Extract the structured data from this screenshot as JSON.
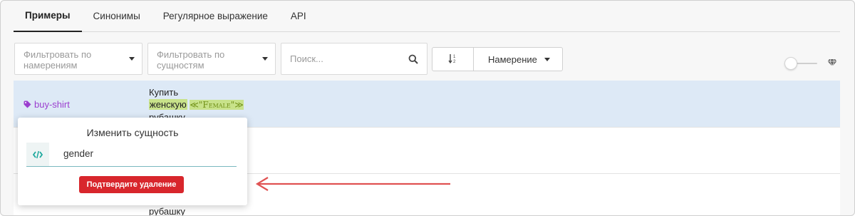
{
  "tabs": [
    {
      "label": "Примеры",
      "active": true
    },
    {
      "label": "Синонимы",
      "active": false
    },
    {
      "label": "Регулярное выражение",
      "active": false
    },
    {
      "label": "API",
      "active": false
    }
  ],
  "filters": {
    "intent_placeholder_line1": "Фильтровать по",
    "intent_placeholder_line2": "намерениям",
    "entity_placeholder_line1": "Фильтровать по",
    "entity_placeholder_line2": "сущностям",
    "search_placeholder": "Поиск..."
  },
  "sort": {
    "label": "Намерение"
  },
  "rows": [
    {
      "intent": "buy-shirt",
      "line1": "Купить",
      "entity_word": "женскую",
      "entity_open": "≪\"",
      "entity_value": "Female",
      "entity_close": "\"≫",
      "line3": "рубашку"
    },
    {
      "intent": "",
      "line3": "рубашку"
    }
  ],
  "popup": {
    "title": "Изменить сущность",
    "entity_name": "gender",
    "confirm_label": "Подтвердите удаление"
  },
  "colors": {
    "selected_row": "#dde9f6",
    "intent_tag": "#9b3fcf",
    "entity_highlight": "#c8e28a",
    "danger": "#d8262c",
    "arrow": "#e05252"
  }
}
